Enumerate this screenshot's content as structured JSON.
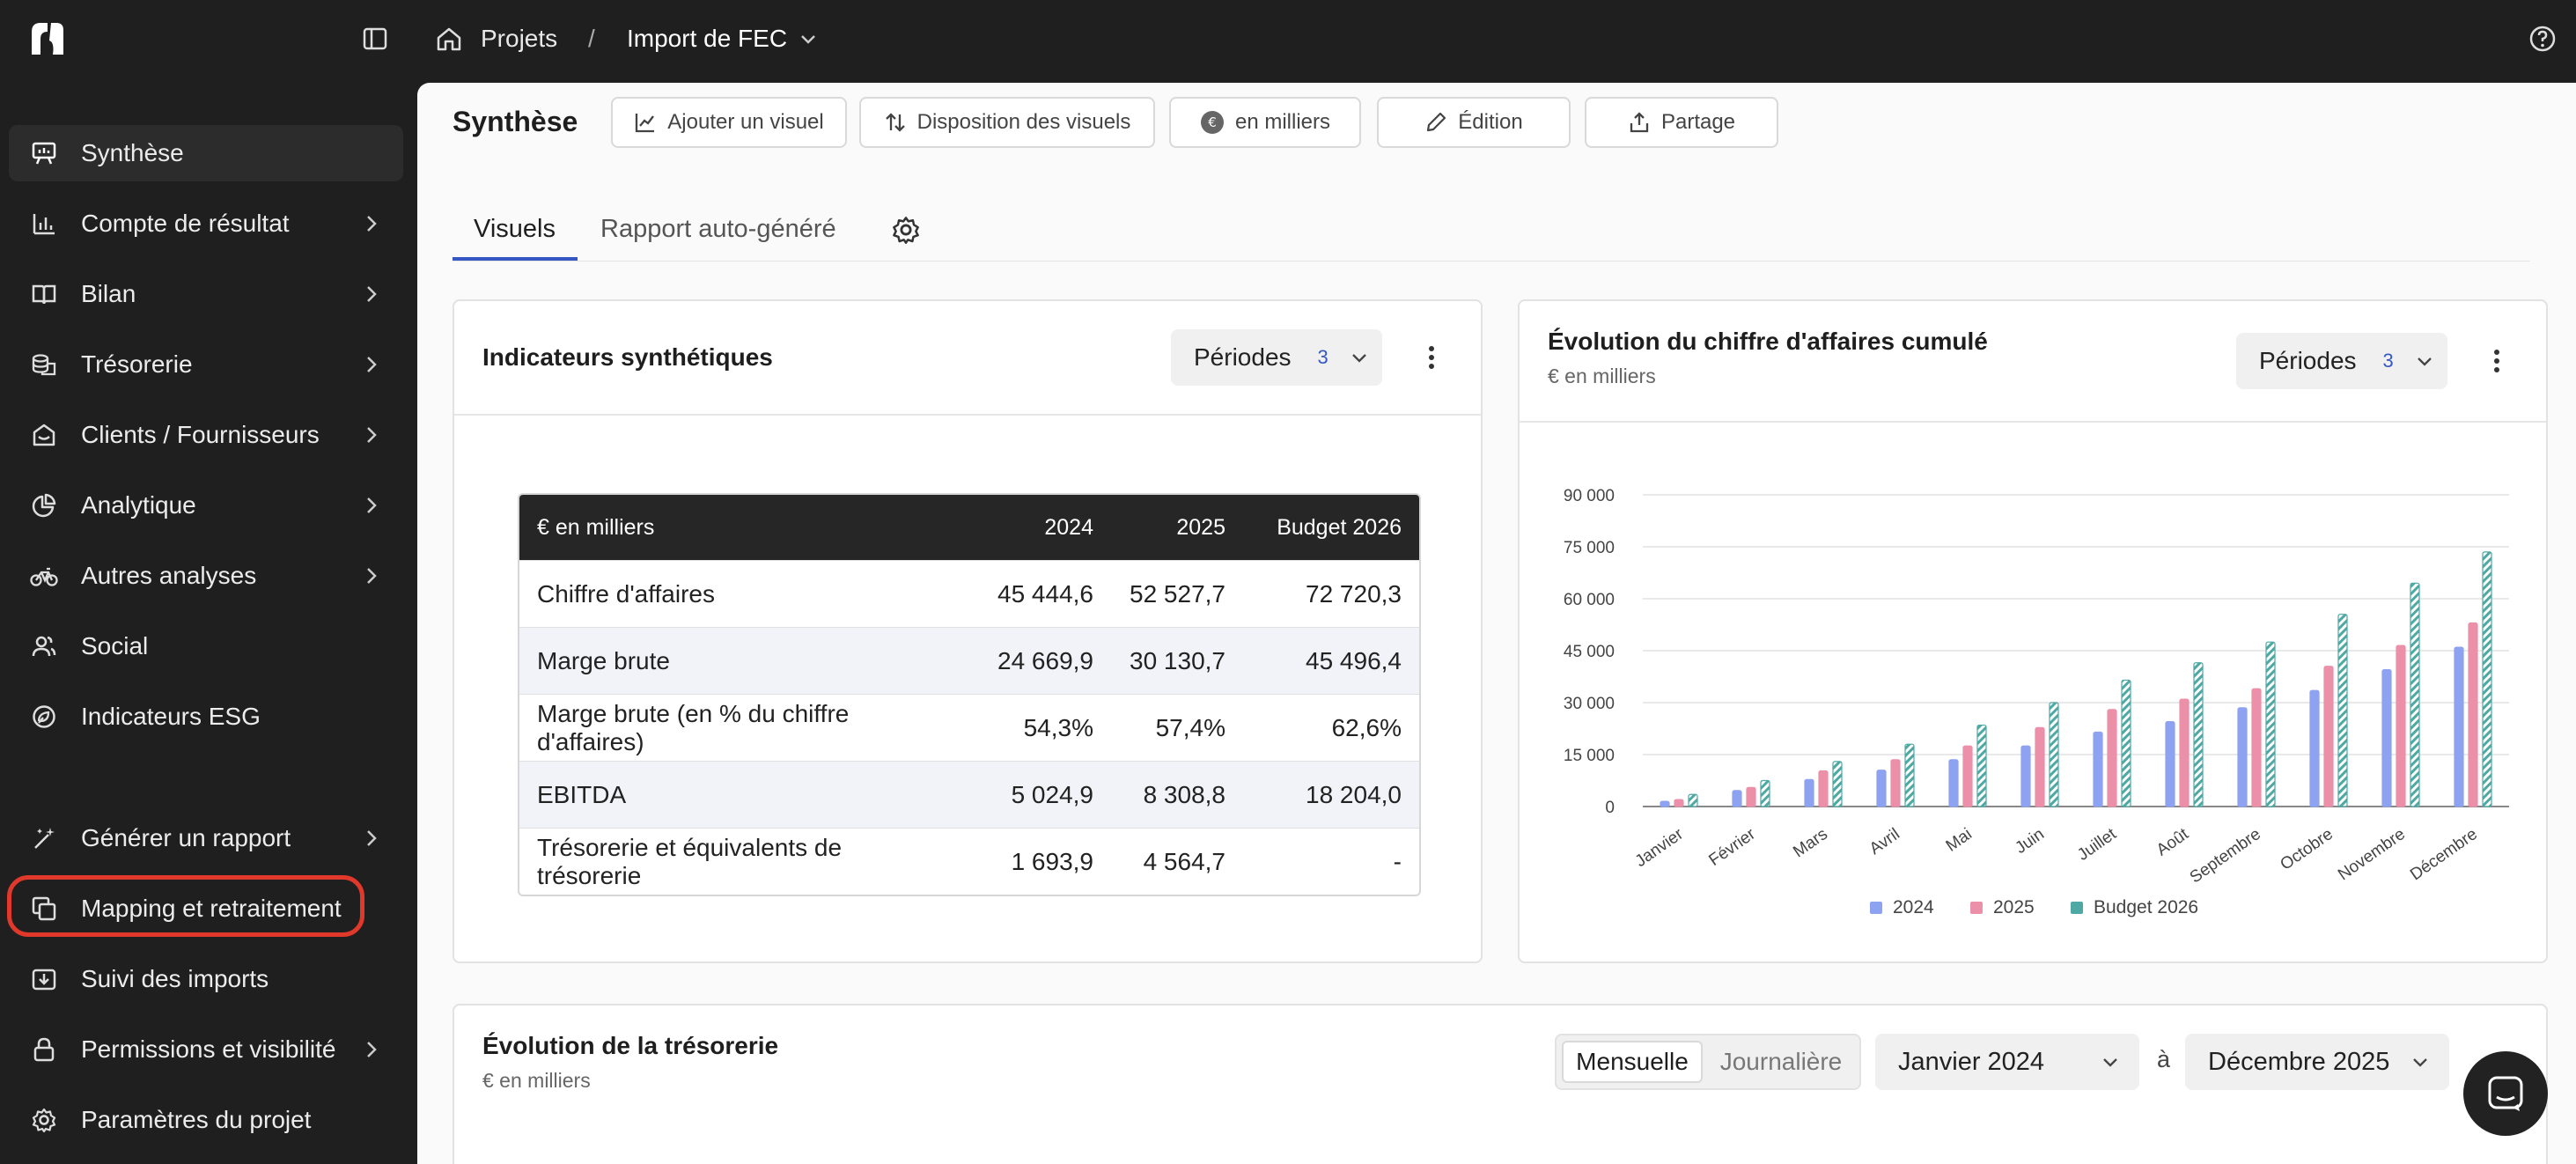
{
  "topbar": {
    "breadcrumb_root": "Projets",
    "breadcrumb_sep": "/",
    "breadcrumb_current": "Import de FEC"
  },
  "sidebar": {
    "items": [
      {
        "label": "Synthèse",
        "icon": "presentation-chart-icon",
        "chevron": false,
        "active": true
      },
      {
        "label": "Compte de résultat",
        "icon": "bar-chart-icon",
        "chevron": true
      },
      {
        "label": "Bilan",
        "icon": "book-icon",
        "chevron": true
      },
      {
        "label": "Trésorerie",
        "icon": "coins-icon",
        "chevron": true
      },
      {
        "label": "Clients / Fournisseurs",
        "icon": "store-icon",
        "chevron": true
      },
      {
        "label": "Analytique",
        "icon": "pie-chart-icon",
        "chevron": true
      },
      {
        "label": "Autres analyses",
        "icon": "bike-icon",
        "chevron": true
      },
      {
        "label": "Social",
        "icon": "users-icon",
        "chevron": false
      },
      {
        "label": "Indicateurs ESG",
        "icon": "leaf-globe-icon",
        "chevron": false
      },
      {
        "label": "Générer un rapport",
        "icon": "magic-wand-icon",
        "chevron": true
      },
      {
        "label": "Mapping et retraitement",
        "icon": "copy-icon",
        "chevron": false,
        "highlighted": true
      },
      {
        "label": "Suivi des imports",
        "icon": "import-icon",
        "chevron": false
      },
      {
        "label": "Permissions et visibilité",
        "icon": "lock-icon",
        "chevron": true
      },
      {
        "label": "Paramètres du projet",
        "icon": "gear-icon",
        "chevron": false
      }
    ]
  },
  "main": {
    "title": "Synthèse",
    "toolbar": {
      "add_visual": "Ajouter un visuel",
      "layout": "Disposition des visuels",
      "units": "en milliers",
      "edit": "Édition",
      "share": "Partage"
    },
    "tabs": [
      "Visuels",
      "Rapport auto-généré"
    ],
    "indicators": {
      "title": "Indicateurs synthétiques",
      "periods_label": "Périodes",
      "periods_count": "3",
      "table": {
        "headers": [
          "€ en milliers",
          "2024",
          "2025",
          "Budget 2026"
        ],
        "rows": [
          [
            "Chiffre d'affaires",
            "45 444,6",
            "52 527,7",
            "72 720,3"
          ],
          [
            "Marge brute",
            "24 669,9",
            "30 130,7",
            "45 496,4"
          ],
          [
            "Marge brute (en % du chiffre d'affaires)",
            "54,3%",
            "57,4%",
            "62,6%"
          ],
          [
            "EBITDA",
            "5 024,9",
            "8 308,8",
            "18 204,0"
          ],
          [
            "Trésorerie et équivalents de trésorerie",
            "1 693,9",
            "4 564,7",
            "-"
          ]
        ]
      }
    },
    "revenue_chart": {
      "title": "Évolution du chiffre d'affaires cumulé",
      "subtitle": "€ en milliers",
      "periods_label": "Périodes",
      "periods_count": "3"
    },
    "treasury": {
      "title": "Évolution de la trésorerie",
      "subtitle": "€ en milliers",
      "mode_on": "Mensuelle",
      "mode_off": "Journalière",
      "from": "Janvier 2024",
      "to_label": "à",
      "to": "Décembre 2025"
    }
  },
  "chart_data": {
    "type": "bar",
    "title": "Évolution du chiffre d'affaires cumulé",
    "categories": [
      "Janvier",
      "Février",
      "Mars",
      "Avril",
      "Mai",
      "Juin",
      "Juillet",
      "Août",
      "Septembre",
      "Octobre",
      "Novembre",
      "Décembre"
    ],
    "series": [
      {
        "name": "2024",
        "color": "#8ea2f2",
        "values": [
          1500,
          4600,
          7800,
          10500,
          13500,
          17500,
          21500,
          24500,
          28500,
          33500,
          39500,
          46000
        ]
      },
      {
        "name": "2025",
        "color": "#ec8fa9",
        "values": [
          2000,
          5500,
          10300,
          13500,
          17500,
          22800,
          28000,
          31000,
          34000,
          40500,
          46500,
          53000
        ]
      },
      {
        "name": "Budget 2026",
        "color": "#4ea8a3",
        "values": [
          3500,
          7500,
          13000,
          18000,
          23500,
          30000,
          36500,
          41500,
          47500,
          55500,
          64500,
          73500
        ]
      }
    ],
    "yticks": [
      "90 000",
      "75 000",
      "60 000",
      "45 000",
      "30 000",
      "15 000",
      "0"
    ],
    "ylim": [
      0,
      90000
    ],
    "grid": true,
    "legend": "bottom"
  }
}
